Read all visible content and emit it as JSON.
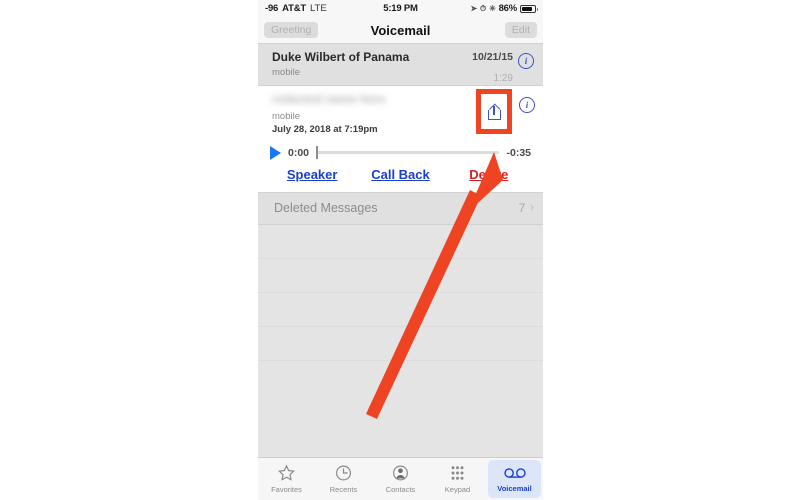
{
  "status_bar": {
    "signal": "-96",
    "carrier": "AT&T",
    "network": "LTE",
    "time": "5:19 PM",
    "battery_percent": "86%",
    "icons": [
      "location-arrow-icon",
      "alarm-icon",
      "bluetooth-icon",
      "battery-icon"
    ]
  },
  "nav_bar": {
    "left_button": "Greeting",
    "title": "Voicemail",
    "right_button": "Edit"
  },
  "voicemails": [
    {
      "name": "Duke Wilbert of Panama",
      "line_type": "mobile",
      "date": "10/21/15",
      "duration": "1:29",
      "expanded": false,
      "blurred": false
    },
    {
      "name": "",
      "line_type": "mobile",
      "date": "July 28, 2018 at 7:19pm",
      "expanded": true,
      "blurred": true
    }
  ],
  "player": {
    "current_time": "0:00",
    "remaining_time": "-0:35",
    "progress_percent": 0,
    "play_label": "play-button"
  },
  "actions": [
    {
      "label": "Speaker",
      "color": "#1a3fd0"
    },
    {
      "label": "Call Back",
      "color": "#1a3fd0"
    },
    {
      "label": "Delete",
      "color": "#d62222"
    }
  ],
  "deleted_messages": {
    "label": "Deleted Messages",
    "count": "7",
    "chevron": "›"
  },
  "tab_bar": {
    "items": [
      {
        "label": "Favorites",
        "icon": "star-icon",
        "active": false
      },
      {
        "label": "Recents",
        "icon": "clock-icon",
        "active": false
      },
      {
        "label": "Contacts",
        "icon": "person-icon",
        "active": false
      },
      {
        "label": "Keypad",
        "icon": "keypad-icon",
        "active": false
      },
      {
        "label": "Voicemail",
        "icon": "voicemail-icon",
        "active": true
      }
    ]
  },
  "annotation": {
    "highlight_color": "#ef4423",
    "target": "share-button",
    "arrow": "points-to-share-button"
  },
  "colors": {
    "accent_blue": "#1a3fd0",
    "tint_blue": "#3f51c4",
    "delete_red": "#d62222",
    "annotation_orange": "#ef4423",
    "screen_gray": "#e4e4e4"
  }
}
